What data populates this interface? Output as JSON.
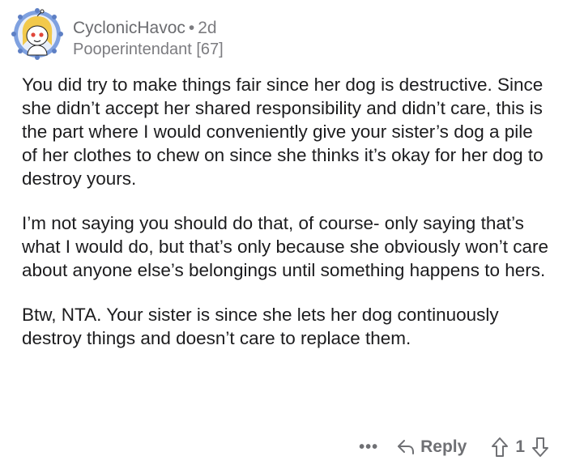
{
  "comment": {
    "username": "CyclonicHavoc",
    "separator": "•",
    "age": "2d",
    "flair": "Pooperintendant [67]",
    "paragraphs": [
      "You did try to make things fair since her dog is destructive. Since she didn’t accept her shared responsibility and didn’t care, this is the part where I would conveniently give your sister’s dog a pile of her clothes to chew on since she thinks it’s okay for her dog to destroy yours.",
      "I’m not saying you should do that, of course- only saying that’s what I would do, but that’s only because she obviously won’t care about anyone else’s belongings until something happens to hers.",
      "Btw, NTA. Your sister is since she lets her dog continuously destroy things and doesn’t care to replace them."
    ]
  },
  "actions": {
    "more": "•••",
    "reply_label": "Reply",
    "vote_count": "1"
  },
  "icons": {
    "avatar": "snoo-avatar-icon",
    "reply": "reply-arrow-icon",
    "upvote": "upvote-arrow-icon",
    "downvote": "downvote-arrow-icon"
  },
  "colors": {
    "text": "#1c1c1e",
    "meta": "#7c7c80",
    "avatar_bg": "#6b8fd6",
    "avatar_hair": "#f2c94c"
  }
}
